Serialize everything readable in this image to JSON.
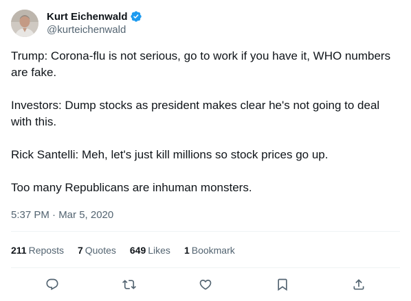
{
  "author": {
    "display_name": "Kurt Eichenwald",
    "handle": "@kurteichenwald",
    "verified": true,
    "verified_color": "#1d9bf0"
  },
  "tweet": {
    "paragraphs": [
      "Trump: Corona-flu is not serious, go to work if you have it, WHO numbers are fake.",
      "Investors: Dump stocks as president makes clear he's not going to deal with this.",
      "Rick Santelli: Meh, let's just kill millions so stock prices go up.",
      "Too many Republicans are inhuman monsters."
    ],
    "timestamp": "5:37 PM · Mar 5, 2020"
  },
  "stats": {
    "reposts_count": "211",
    "reposts_label": "Reposts",
    "quotes_count": "7",
    "quotes_label": "Quotes",
    "likes_count": "649",
    "likes_label": "Likes",
    "bookmarks_count": "1",
    "bookmarks_label": "Bookmark"
  },
  "actions": [
    {
      "icon": "reply-icon"
    },
    {
      "icon": "repost-icon"
    },
    {
      "icon": "like-icon"
    },
    {
      "icon": "bookmark-icon"
    },
    {
      "icon": "share-icon"
    }
  ],
  "colors": {
    "text": "#0f1419",
    "secondary": "#536471",
    "divider": "#eff3f4",
    "accent": "#1d9bf0"
  }
}
